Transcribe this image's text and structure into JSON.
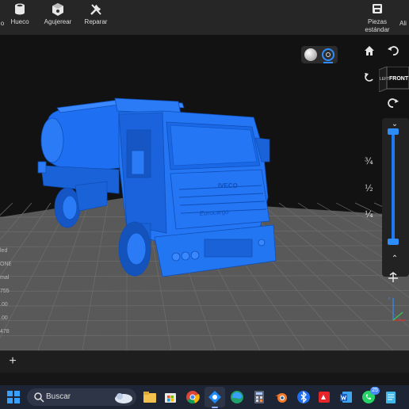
{
  "toolbar": {
    "tools": [
      {
        "id": "hollow",
        "label": "Hueco",
        "icon": "cylinder-hollow-icon"
      },
      {
        "id": "drill",
        "label": "Agujerear",
        "icon": "cube-drill-icon"
      },
      {
        "id": "repair",
        "label": "Reparar",
        "icon": "wrench-repair-icon"
      },
      {
        "id": "std_parts",
        "label": "Piezas\nestándar",
        "icon": "standard-parts-icon"
      },
      {
        "id": "cut_right",
        "label": "Ali",
        "icon": "partial-tool-icon"
      }
    ],
    "left_cut_label": "o"
  },
  "viewport": {
    "render_modes": [
      "solid-shading-icon",
      "xray-mode-icon"
    ],
    "active_render_mode": 1,
    "viewcube": {
      "front": "FRONT",
      "left": "LEFT"
    },
    "zoom": {
      "labels": [
        "¾",
        "½",
        "¼"
      ],
      "value": 0.5
    },
    "model_colors": {
      "model": "#1e6ff2",
      "floor": "#5a5a5a",
      "grid": "#6d6d6d",
      "accent": "#2f8cff"
    },
    "model_text": {
      "grille_brand": "IVECO",
      "bumper_text": "Eurocargo"
    }
  },
  "info_panel": {
    "lines": [
      "led",
      "ONE",
      "mal",
      "755",
      ".00",
      ".00",
      "478"
    ]
  },
  "bottom_bar": {
    "add_label": "+"
  },
  "taskbar": {
    "search_placeholder": "Buscar",
    "whatsapp_badge": "25",
    "apps": [
      "file-explorer-icon",
      "microsoft-store-icon",
      "chrome-icon",
      "slicer-app-icon",
      "edge-icon",
      "calculator-icon",
      "blender-icon",
      "bluetooth-icon",
      "pdf-reader-icon",
      "word-icon",
      "whatsapp-icon",
      "notepad-icon"
    ]
  }
}
